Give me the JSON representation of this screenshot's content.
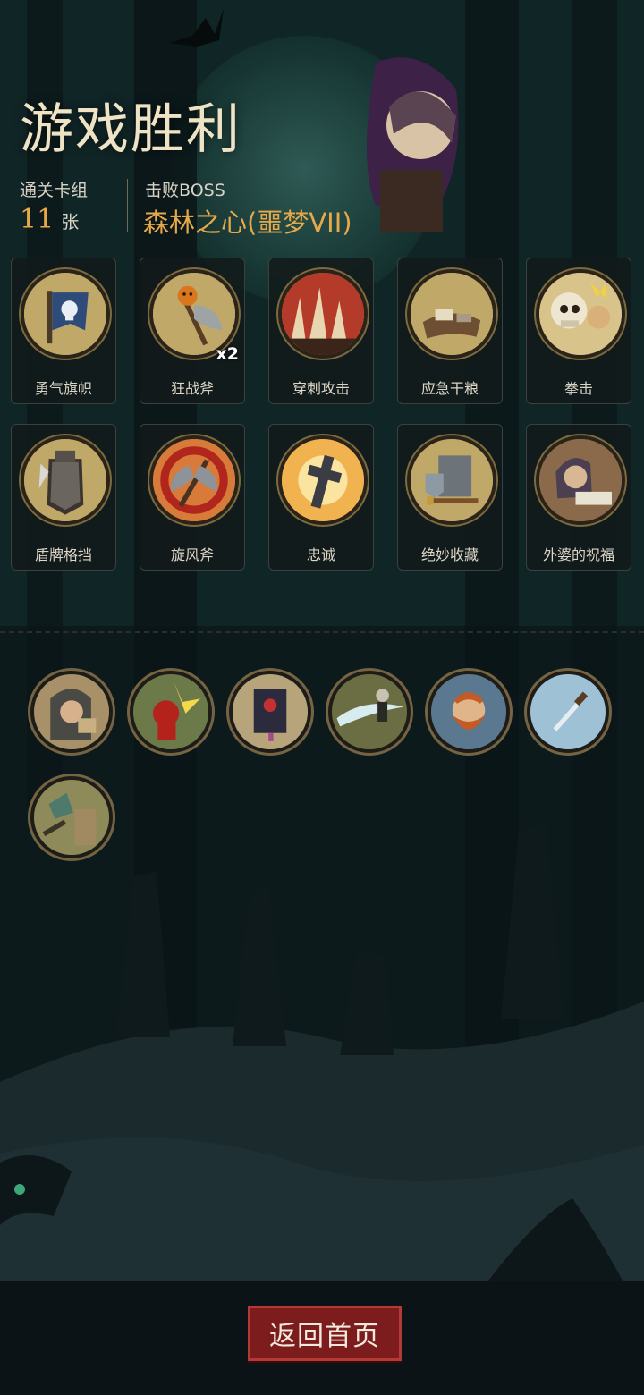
{
  "title": "游戏胜利",
  "stats": {
    "deck_label": "通关卡组",
    "deck_count": "11",
    "deck_unit": "张",
    "boss_label": "击败BOSS",
    "boss_name": "森林之心(噩梦VII)"
  },
  "cards": [
    {
      "name": "勇气旗帜",
      "icon": "skull-banner-icon"
    },
    {
      "name": "狂战斧",
      "icon": "pumpkin-axe-icon",
      "count": "x2"
    },
    {
      "name": "穿刺攻击",
      "icon": "spikes-icon"
    },
    {
      "name": "应急干粮",
      "icon": "rations-icon"
    },
    {
      "name": "拳击",
      "icon": "skeleton-punch-icon"
    },
    {
      "name": "盾牌格挡",
      "icon": "shield-knight-icon"
    },
    {
      "name": "旋风斧",
      "icon": "whirlwind-axe-icon"
    },
    {
      "name": "忠诚",
      "icon": "holy-cross-icon"
    },
    {
      "name": "绝妙收藏",
      "icon": "treasure-collection-icon"
    },
    {
      "name": "外婆的祝福",
      "icon": "grandma-reading-icon"
    }
  ],
  "relics": [
    {
      "icon": "hooded-merchant-icon"
    },
    {
      "icon": "red-imp-icon"
    },
    {
      "icon": "dark-tome-icon"
    },
    {
      "icon": "slash-fighter-icon"
    },
    {
      "icon": "bearded-hero-icon"
    },
    {
      "icon": "dagger-icon"
    },
    {
      "icon": "ruined-tower-icon"
    }
  ],
  "button": {
    "return_home": "返回首页"
  },
  "colors": {
    "accent_gold": "#e6a94a",
    "button_red": "#7c1c1c",
    "frame_gold": "#c9b270"
  }
}
